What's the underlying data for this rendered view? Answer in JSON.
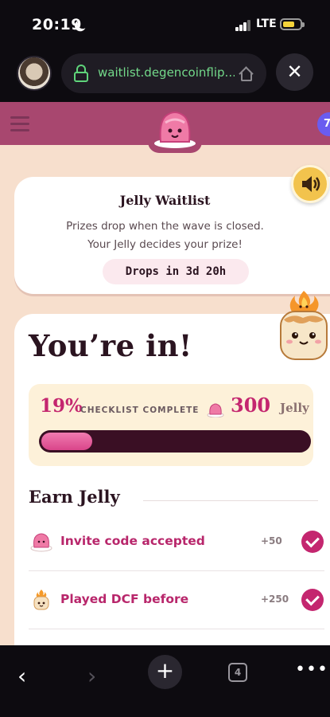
{
  "status_bar": {
    "time": "20:19",
    "network": "LTE"
  },
  "browser": {
    "url": "waitlist.degencoinflip...",
    "close_symbol": "✕"
  },
  "header": {
    "badge_text": "7"
  },
  "waitlist_card": {
    "title": "Jelly Waitlist",
    "line1": "Prizes drop when the wave is closed.",
    "line2": "Your Jelly decides your prize!",
    "drop_countdown": "Drops in 3d 20h"
  },
  "status_card": {
    "headline": "You’re in!",
    "progress_percent_text": "19%",
    "progress_fraction": 0.19,
    "checklist_label": "CHECKLIST COMPLETE",
    "jelly_count": "300",
    "jelly_unit": "Jelly"
  },
  "earn": {
    "heading": "Earn Jelly",
    "tasks": [
      {
        "label": "Invite code accepted",
        "points": "+50",
        "icon": "jelly-icon",
        "done": true
      },
      {
        "label": "Played DCF before",
        "points": "+250",
        "icon": "marshmallow-icon",
        "done": true
      }
    ]
  },
  "bottom_nav": {
    "tab_count": "4"
  },
  "colors": {
    "accent": "#c4266f",
    "header": "#a8476f",
    "page_bg": "#f7dfcd",
    "progress_track": "#3a0f24"
  }
}
